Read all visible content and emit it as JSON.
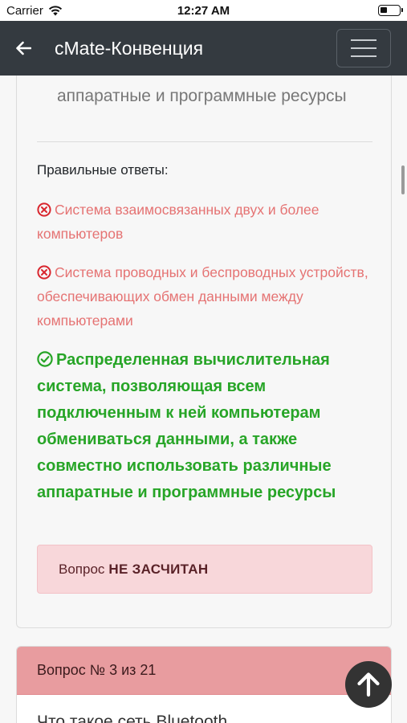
{
  "status_bar": {
    "carrier": "Carrier",
    "time": "12:27 AM"
  },
  "navbar": {
    "title": "cMate-Конвенция"
  },
  "card": {
    "answer_tail": "аппаратные и программные ресурсы",
    "correct_heading": "Правильные ответы:",
    "options": [
      {
        "status": "wrong",
        "icon": "x-circle-icon",
        "text": "Система взаимосвязанных двух и более компьютеров"
      },
      {
        "status": "wrong",
        "icon": "x-circle-icon",
        "text": "Система проводных и беспроводных устройств, обеспечивающих обмен данными между компьютерами"
      },
      {
        "status": "correct",
        "icon": "check-circle-icon",
        "text": "Распределенная вычислительная система, позволяющая всем подключенным к ней компьютерам обмениваться данными, а также совместно использовать различные аппаратные и программные ресурсы"
      }
    ],
    "verdict": {
      "prefix": "Вопрос",
      "status": "НЕ ЗАСЧИТАН"
    }
  },
  "next_card": {
    "header": "Вопрос № 3 из 21",
    "question_start": "Что такое сеть Bluetooth"
  },
  "colors": {
    "navbar": "#343a40",
    "wrong": "#e57373",
    "correct": "#27a527",
    "verdict_bg": "#f8d7da",
    "next_header_bg": "#e89c9f"
  }
}
